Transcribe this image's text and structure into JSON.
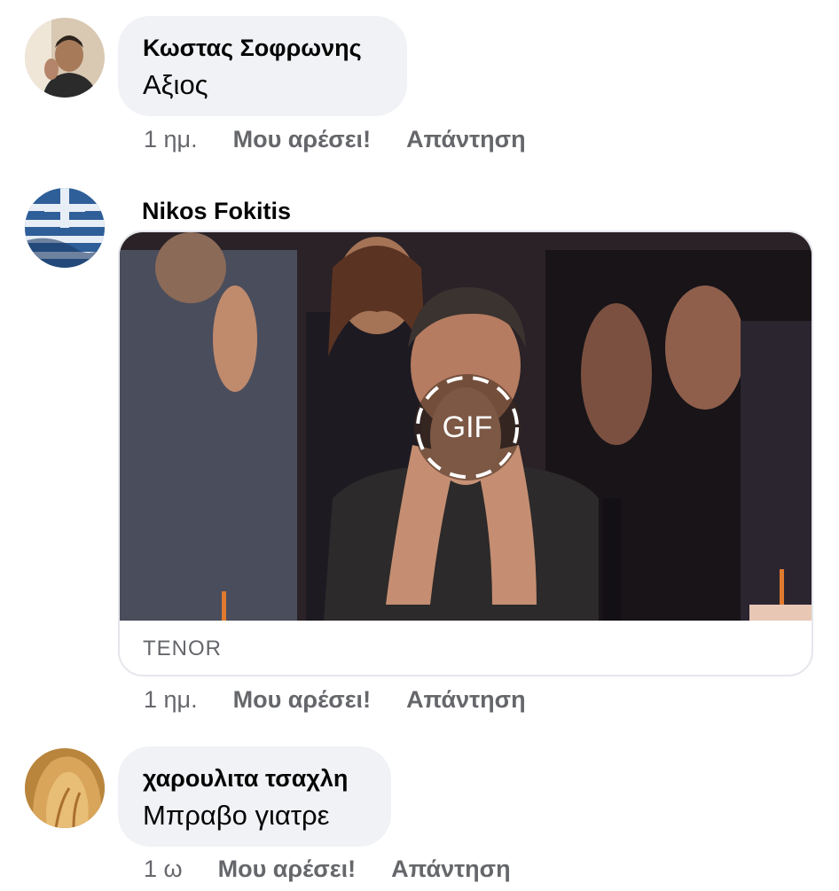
{
  "comments": [
    {
      "author": "Κωστας Σοφρωνης",
      "text": "Αξιος",
      "time": "1 ημ.",
      "like_label": "Μου αρέσει!",
      "reply_label": "Απάντηση"
    },
    {
      "author": "Nikos Fokitis",
      "gif": {
        "badge": "GIF",
        "source": "TENOR"
      },
      "time": "1 ημ.",
      "like_label": "Μου αρέσει!",
      "reply_label": "Απάντηση"
    },
    {
      "author": "χαρουλιτα τσαχλη",
      "text": "Μπραβο γιατρε",
      "time": "1 ω",
      "like_label": "Μου αρέσει!",
      "reply_label": "Απάντηση"
    }
  ],
  "colors": {
    "bubble": "#f0f2f5",
    "meta_text": "#65676b",
    "primary_text": "#050505"
  }
}
